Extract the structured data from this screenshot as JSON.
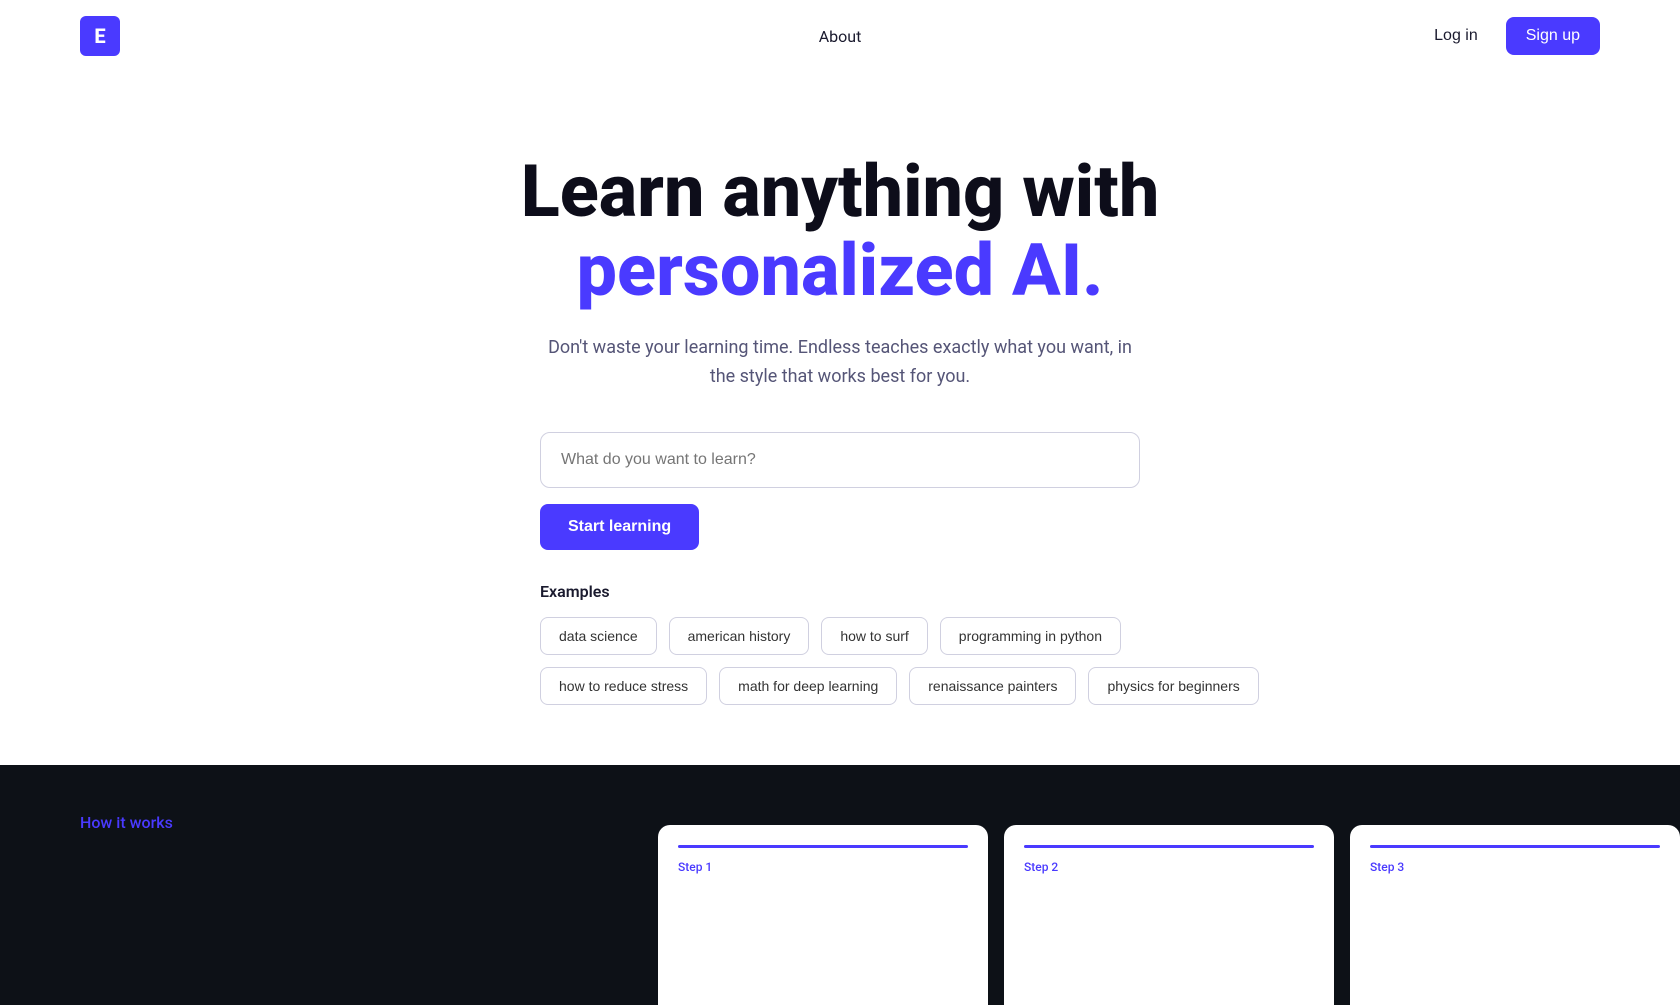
{
  "nav": {
    "logo_letter": "E",
    "about_label": "About",
    "login_label": "Log in",
    "signup_label": "Sign up"
  },
  "hero": {
    "title_line1": "Learn anything with",
    "title_line2": "personalized AI.",
    "subtitle": "Don't waste your learning time. Endless teaches exactly what you want, in the style that works best for you."
  },
  "search": {
    "placeholder": "What do you want to learn?",
    "button_label": "Start learning"
  },
  "examples": {
    "label": "Examples",
    "row1": [
      "data science",
      "american history",
      "how to surf",
      "programming in python"
    ],
    "row2": [
      "how to reduce stress",
      "math for deep learning",
      "renaissance painters",
      "physics for beginners"
    ]
  },
  "bottom": {
    "how_it_works_label": "How it works",
    "step1_label": "Step 1",
    "step2_label": "Step 2",
    "step3_label": "Step 3"
  },
  "colors": {
    "accent": "#4A3AFF",
    "dark_bg": "#0d1117",
    "text_dark": "#0d0d1a",
    "text_muted": "#555577"
  }
}
